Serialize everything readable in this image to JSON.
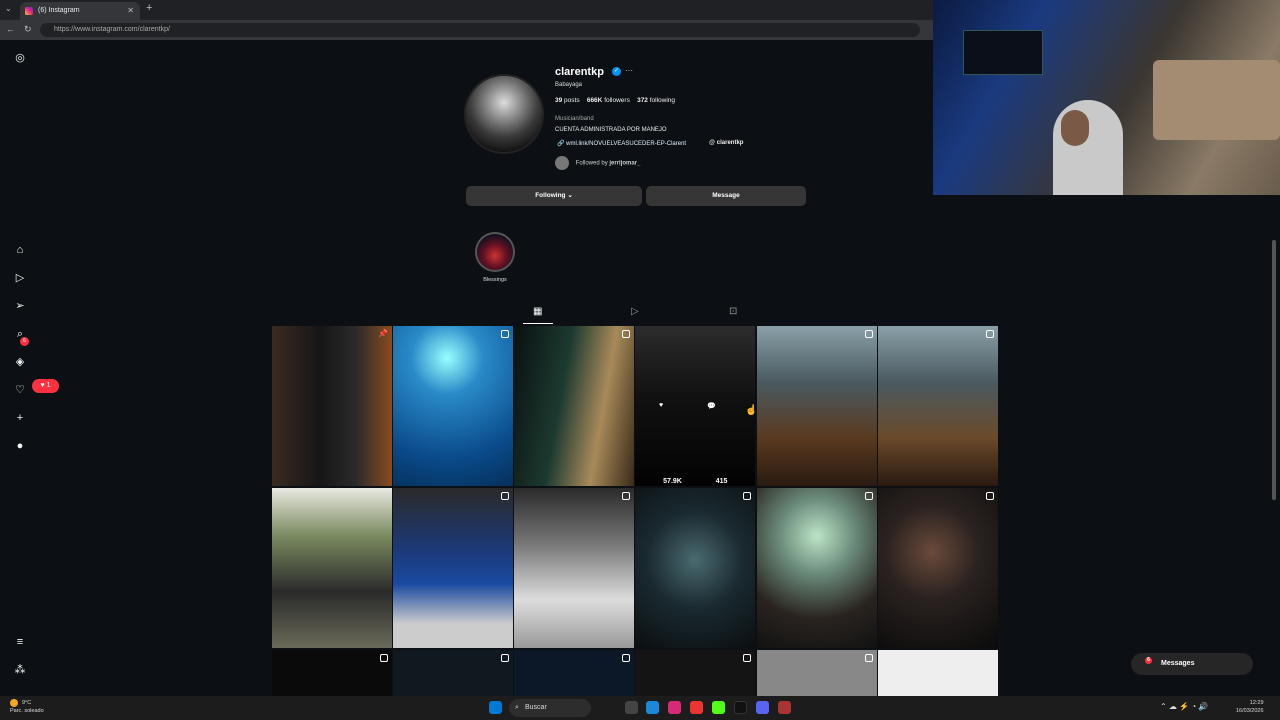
{
  "browser": {
    "tab_title": "(6) Instagram",
    "url": "https://www.instagram.com/clarentkp/"
  },
  "sidebar": {
    "notification_count": "6",
    "like_count": "1"
  },
  "profile": {
    "username": "clarentkp",
    "full_name": "Babayaga",
    "posts": "39",
    "posts_label": "posts",
    "followers": "666K",
    "followers_label": "followers",
    "following": "372",
    "following_label": "following",
    "category": "Musician/band",
    "bio": "CUENTA ADMINISTRADA POR MANEJO",
    "link": "wml.link/NOVUELVEASUCEDER-EP-Clarent",
    "threads_handle": "clarentkp",
    "followed_by_prefix": "Followed by",
    "followed_by_user": "jerrijomar_"
  },
  "actions": {
    "following_label": "Following",
    "message_label": "Message"
  },
  "highlights": [
    {
      "label": "Blessings"
    }
  ],
  "post_overlay": {
    "likes": "57.9K",
    "comments": "415"
  },
  "messages": {
    "label": "Messages",
    "count": "6"
  },
  "taskbar": {
    "temperature": "9°C",
    "weather": "Parc. soleado",
    "search_placeholder": "Buscar",
    "time": "12:29",
    "date": "16/03/2026"
  },
  "colors": {
    "accent": "#0095f6",
    "notification": "#ff3040",
    "background": "#0c1014"
  }
}
